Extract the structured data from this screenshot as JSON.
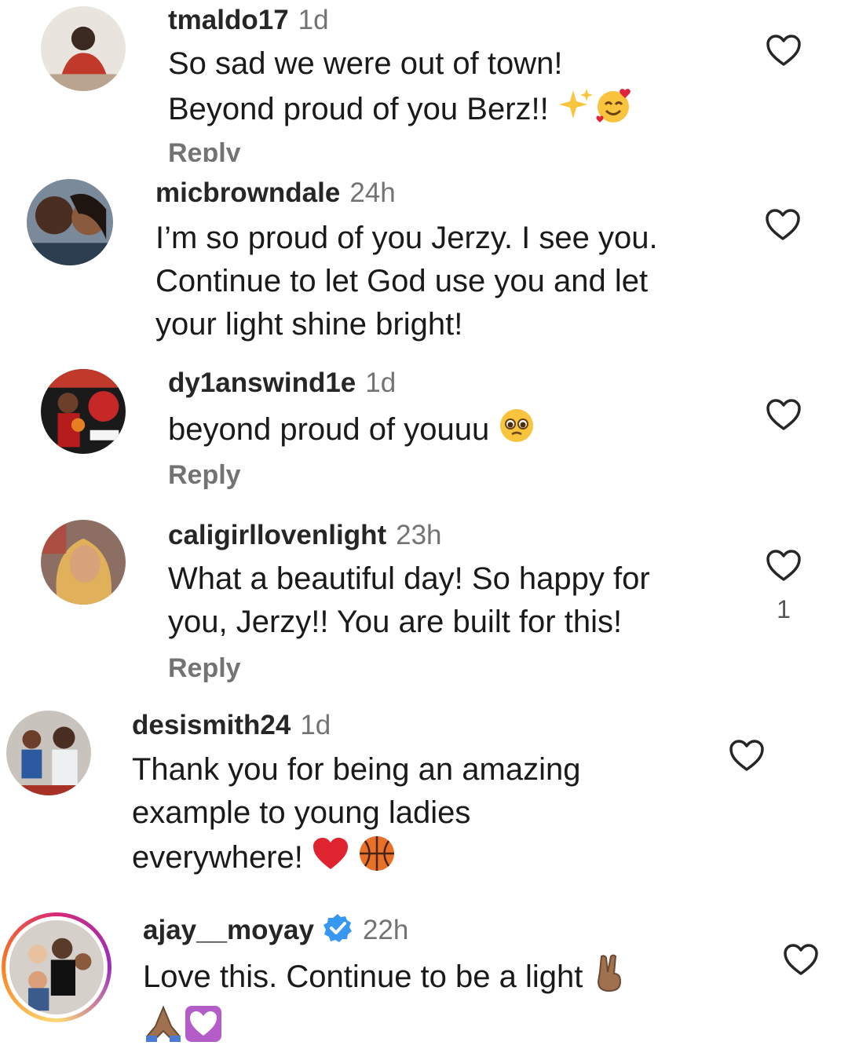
{
  "comments": [
    {
      "username": "tmaldo17",
      "time": "1d",
      "line1": "So sad we were out of town!",
      "line2": "Beyond proud of you Berz!!",
      "emoji_icons": [
        "sparkles-icon",
        "smiling-face-with-hearts-icon"
      ],
      "reply_label": "Reply"
    },
    {
      "username": "micbrowndale",
      "time": "24h",
      "line1": "I’m so proud of you Jerzy. I see you.",
      "line2": "Continue to let God use you and let",
      "line3": "your light shine bright!"
    },
    {
      "username": "dy1answind1e",
      "time": "1d",
      "line1": "beyond proud of youuu",
      "emoji_icons": [
        "pleading-face-icon"
      ],
      "reply_label": "Reply"
    },
    {
      "username": "caligirllovenlight",
      "time": "23h",
      "line1": "What a beautiful day! So happy for",
      "line2": "you, Jerzy!! You are built for this!",
      "reply_label": "Reply",
      "like_count": "1"
    },
    {
      "username": "desismith24",
      "time": "1d",
      "line1": "Thank you for being an amazing",
      "line2": "example to young ladies",
      "line3": "everywhere!",
      "emoji_icons": [
        "red-heart-icon",
        "basketball-icon"
      ]
    },
    {
      "username": "ajay__moyay",
      "time": "22h",
      "verified": true,
      "line1": "Love this. Continue to be a light",
      "emoji_icons": [
        "victory-hand-icon",
        "folded-hands-icon",
        "heart-decoration-icon"
      ]
    }
  ],
  "colors": {
    "username": "#262626",
    "meta": "#737373",
    "heart_outline": "#262626",
    "verified_blue": "#3897f0",
    "story_ring": [
      "#d62976",
      "#962fbf",
      "#feda75",
      "#fa7e1e"
    ]
  }
}
